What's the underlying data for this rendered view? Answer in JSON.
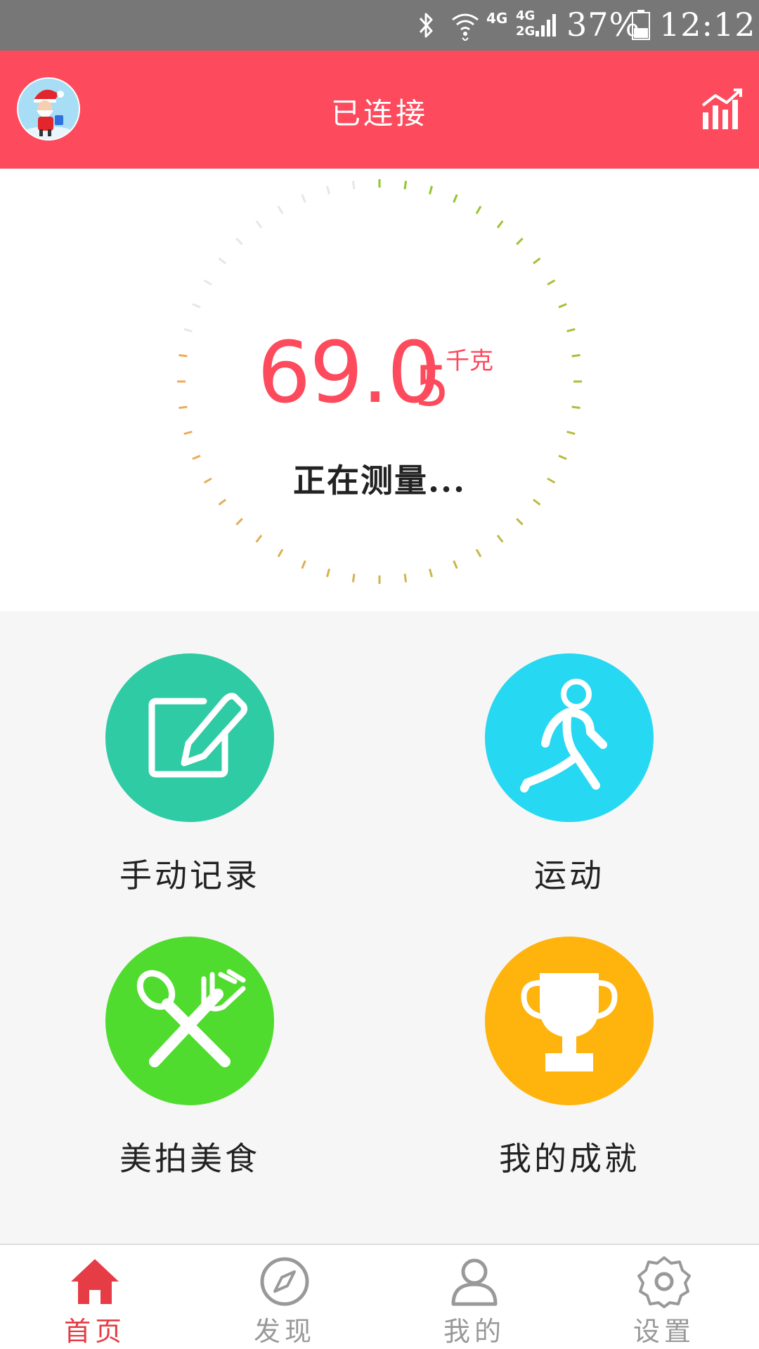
{
  "status_bar": {
    "network_1": "4G",
    "network_2_top": "4G",
    "network_2_bottom": "2G",
    "battery_percent": "37%",
    "time": "12:12"
  },
  "header": {
    "title": "已连接"
  },
  "measurement": {
    "value_main": "69.0",
    "value_small": "5",
    "unit": "千克",
    "status": "正在测量..."
  },
  "features": [
    {
      "label": "手动记录",
      "color": "#2ecba4",
      "icon": "edit-icon"
    },
    {
      "label": "运动",
      "color": "#27d8f2",
      "icon": "running-icon"
    },
    {
      "label": "美拍美食",
      "color": "#50dc2e",
      "icon": "utensils-icon"
    },
    {
      "label": "我的成就",
      "color": "#feb30d",
      "icon": "trophy-icon"
    }
  ],
  "bottom_nav": [
    {
      "label": "首页",
      "icon": "home-icon",
      "active": true
    },
    {
      "label": "发现",
      "icon": "compass-icon",
      "active": false
    },
    {
      "label": "我的",
      "icon": "user-icon",
      "active": false
    },
    {
      "label": "设置",
      "icon": "settings-icon",
      "active": false
    }
  ],
  "colors": {
    "accent": "#fd4a5c",
    "status_bar": "#777777",
    "nav_active": "#e53c45",
    "nav_inactive": "#999999"
  }
}
